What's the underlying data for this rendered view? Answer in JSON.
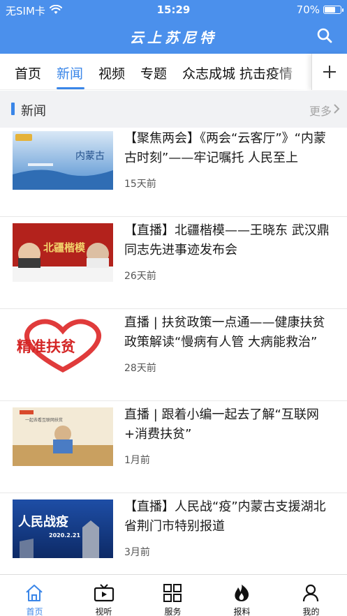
{
  "status_bar": {
    "carrier": "无SIM卡",
    "time": "15:29",
    "battery": "70%",
    "battery_level": 0.7
  },
  "header": {
    "title": "云上苏尼特",
    "search_icon": "search-icon"
  },
  "tabs": [
    {
      "label": "首页",
      "active": false
    },
    {
      "label": "新闻",
      "active": true
    },
    {
      "label": "视频",
      "active": false
    },
    {
      "label": "专题",
      "active": false
    },
    {
      "label": "众志成城 抗击疫情",
      "active": false
    }
  ],
  "add_tab_icon": "plus-icon",
  "section": {
    "title": "新闻",
    "more": "更多"
  },
  "news": [
    {
      "title": "【聚焦两会】《两会“云客厅”》“内蒙古时刻”——牢记嘱托 人民至上",
      "time": "15天前",
      "thumb_text": "内蒙古"
    },
    {
      "title": "【直播】北疆楷模——王晓东 武汉鼎同志先进事迹发布会",
      "time": "26天前",
      "thumb_text": "北疆楷模"
    },
    {
      "title": "直播 | 扶贫政策一点通——健康扶贫政策解读“慢病有人管 大病能救治”",
      "time": "28天前",
      "thumb_text": "精准扶贫"
    },
    {
      "title": "直播 | 跟着小编一起去了解“互联网+消费扶贫”",
      "time": "1月前",
      "thumb_text": "一起去看互联网扶贫"
    },
    {
      "title": "【直播】人民战“疫”内蒙古支援湖北省荆门市特别报道",
      "time": "3月前",
      "thumb_text": "人民战疫",
      "thumb_date": "2020.2.21"
    }
  ],
  "bottom_nav": [
    {
      "label": "首页",
      "icon": "home-icon",
      "active": true
    },
    {
      "label": "视听",
      "icon": "tv-icon",
      "active": false
    },
    {
      "label": "服务",
      "icon": "grid-icon",
      "active": false
    },
    {
      "label": "报料",
      "icon": "flame-icon",
      "active": false
    },
    {
      "label": "我的",
      "icon": "user-icon",
      "active": false
    }
  ],
  "colors": {
    "primary": "#4b90ec",
    "accent": "#3a86e8"
  }
}
